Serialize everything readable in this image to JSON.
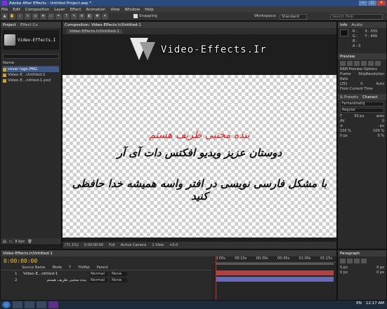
{
  "window": {
    "title": "Adobe After Effects - Untitled Project.aep *",
    "buttons": [
      "—",
      "□",
      "✕"
    ]
  },
  "menu": [
    "File",
    "Edit",
    "Composition",
    "Layer",
    "Effect",
    "Animation",
    "View",
    "Window",
    "Help"
  ],
  "toolbar": {
    "snapping_label": "Snapping",
    "workspace_label": "Workspace:",
    "workspace_value": "Standard",
    "search_placeholder": "Search Help"
  },
  "project": {
    "tabs": [
      "Project",
      "Effect Co"
    ],
    "thumb_name": "Video-Effects.I",
    "column_name": "Name",
    "items": [
      "cover logo.PNG",
      "Video-E...Untitled-1",
      "Video-E...ntitled-1.psd"
    ],
    "bpc": "8 bpc"
  },
  "comp": {
    "tab": "Composition: Video-Effects.Ir/Untitled-1",
    "subtab": "Video-Effects.Ir/Untitled-1",
    "watermark": "Video-Effects.Ir",
    "line_red": "بنده مجتبی ظریف هستم",
    "line_1": "دوستان عزیز ویدیو افکتس دات آی آر",
    "line_2": "با مشکل فارسی نویسی در افتر واسه همیشه خدا حافظی کنید",
    "footer": {
      "zoom": "(71.1%)",
      "time": "0:00:00:00",
      "quality": "Full",
      "camera": "Active Camera",
      "views": "1 View",
      "offset": "+0.0"
    }
  },
  "right": {
    "tabs": [
      "Info",
      "Audio"
    ],
    "info_lines": [
      "R :",
      "G :",
      "B :",
      "A : 0"
    ],
    "coords": [
      "X : 555",
      "Y : 449"
    ],
    "preview_tab": "Preview",
    "ram_options": "RAM Preview Options",
    "frame_rate_label": "Frame Rate",
    "frame_rate_value": "(25)",
    "skip_label": "Skip",
    "skip_value": "0",
    "resolution_label": "Resolution",
    "resolution_value": "Auto",
    "from_current": "From Current Time",
    "char_tabs": [
      "& Presets",
      "Charact"
    ],
    "font_family": "Farhankhatiq",
    "font_style": "Regular",
    "size_value": "93 px",
    "leading_value": "auto",
    "tracking_value": "0",
    "stroke_width": "- px",
    "scale_v": "100 %",
    "scale_h": "100 %",
    "baseline": "0 px",
    "tsume": "0 %"
  },
  "timeline": {
    "tab": "Video-Effects.Ir/Untitled-1",
    "time": "0:00:00:00",
    "columns": [
      "Source Name",
      "Mode",
      "T",
      "TrkMat",
      "Parent"
    ],
    "layers": [
      {
        "num": "1",
        "name": "Video-E...ntitled-1",
        "mode": "Normal",
        "parent": "None"
      },
      {
        "num": "2",
        "name": "بنده مجتبی ظریف هستم",
        "mode": "Normal",
        "parent": "None"
      }
    ],
    "ruler": [
      "0:00s",
      "00:15s",
      "00:30s",
      "00:45s",
      "01:00s",
      "01:15s"
    ]
  },
  "paragraph": {
    "tab": "Paragraph",
    "fields": [
      "0 px",
      "0 px",
      "0 px",
      "0 px"
    ]
  },
  "taskbar": {
    "lang": "EN",
    "clock": "12:17 AM"
  }
}
